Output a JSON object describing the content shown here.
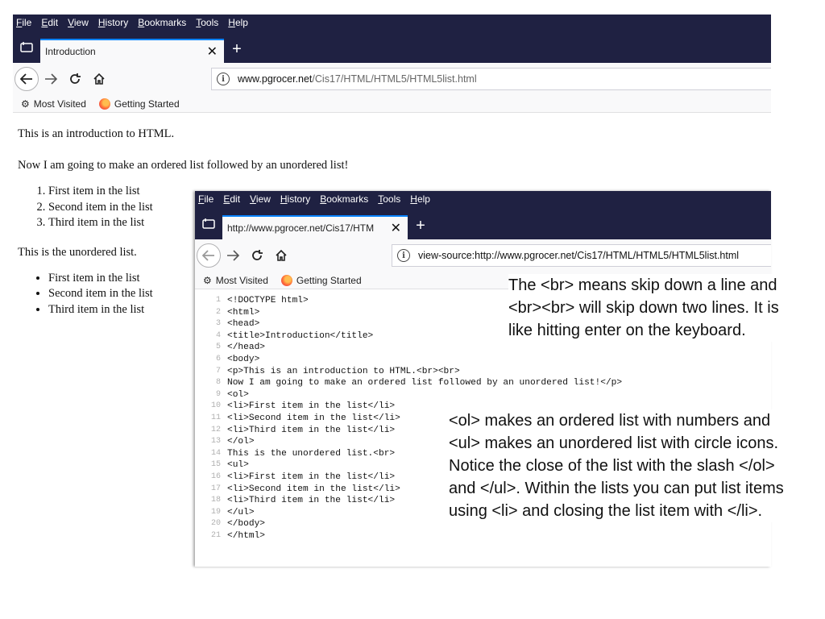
{
  "window1": {
    "menu": [
      "File",
      "Edit",
      "View",
      "History",
      "Bookmarks",
      "Tools",
      "Help"
    ],
    "tab_title": "Introduction",
    "url_host": "www.pgrocer.net",
    "url_path": "/Cis17/HTML/HTML5/HTML5list.html",
    "bookmarks": [
      "Most Visited",
      "Getting Started"
    ],
    "content": {
      "intro": "This is an introduction to HTML.",
      "line2": "Now I am going to make an ordered list followed by an unordered list!",
      "ordered": [
        "First item in the list",
        "Second item in the list",
        "Third item in the list"
      ],
      "unordered_label": "This is the unordered list.",
      "unordered": [
        "First item in the list",
        "Second item in the list",
        "Third item in the list"
      ]
    }
  },
  "window2": {
    "menu": [
      "File",
      "Edit",
      "View",
      "History",
      "Bookmarks",
      "Tools",
      "Help"
    ],
    "tab_title": "http://www.pgrocer.net/Cis17/HTM",
    "url": "view-source:http://www.pgrocer.net/Cis17/HTML/HTML5/HTML5list.html",
    "bookmarks": [
      "Most Visited",
      "Getting Started"
    ],
    "source_lines": [
      "<!DOCTYPE html>",
      "<html>",
      "<head>",
      "<title>Introduction</title>",
      "</head>",
      "<body>",
      "<p>This is an introduction to HTML.<br><br>",
      "Now I am going to make an ordered list followed by an unordered list!</p>",
      "<ol>",
      "<li>First item in the list</li>",
      "<li>Second item in the list</li>",
      "<li>Third item in the list</li>",
      "</ol>",
      "This is the unordered list.<br>",
      "<ul>",
      "<li>First item in the list</li>",
      "<li>Second item in the list</li>",
      "<li>Third item in the list</li>",
      "</ul>",
      "</body>",
      "</html>"
    ]
  },
  "annotations": {
    "note1": "The <br> means skip down a line and <br><br> will skip down two lines.  It is like hitting enter on the keyboard.",
    "note2": "<ol> makes an ordered list with numbers and <ul> makes an unordered list with circle icons. Notice the close of the list with the slash </ol> and </ul>. Within the lists you can put list items using <li> and closing the list item with </li>."
  }
}
